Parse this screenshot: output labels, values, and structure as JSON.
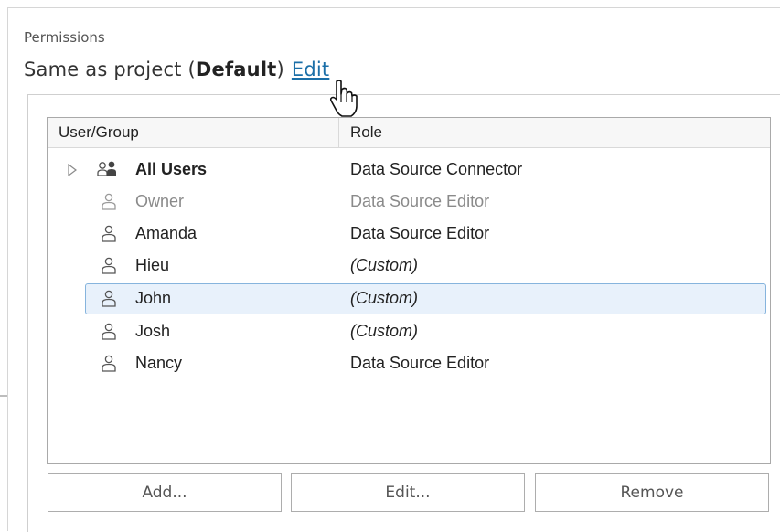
{
  "section": {
    "label": "Permissions"
  },
  "status": {
    "prefix": "Same as project (",
    "default_word": "Default",
    "suffix": ")",
    "edit_link": "Edit"
  },
  "grid": {
    "columns": [
      "User/Group",
      "Role"
    ],
    "rows": [
      {
        "name": "All Users",
        "role": "Data Source Connector",
        "type": "group",
        "state": "normal"
      },
      {
        "name": "Owner",
        "role": "Data Source Editor",
        "type": "user",
        "state": "muted"
      },
      {
        "name": "Amanda",
        "role": "Data Source Editor",
        "type": "user",
        "state": "normal"
      },
      {
        "name": "Hieu",
        "role": "(Custom)",
        "type": "user",
        "state": "normal"
      },
      {
        "name": "John",
        "role": "(Custom)",
        "type": "user",
        "state": "selected"
      },
      {
        "name": "Josh",
        "role": "(Custom)",
        "type": "user",
        "state": "normal"
      },
      {
        "name": "Nancy",
        "role": "Data Source Editor",
        "type": "user",
        "state": "normal"
      }
    ]
  },
  "buttons": {
    "add": "Add...",
    "edit": "Edit...",
    "remove": "Remove"
  },
  "icons": {
    "group": "group-icon",
    "user": "user-icon",
    "expander": "expand-triangle-icon",
    "cursor": "hand-pointer-icon"
  },
  "colors": {
    "link": "#1b6fa8",
    "selection_fill": "#e8f1fb",
    "selection_border": "#86b4dd",
    "muted_text": "#8a8a8a"
  }
}
